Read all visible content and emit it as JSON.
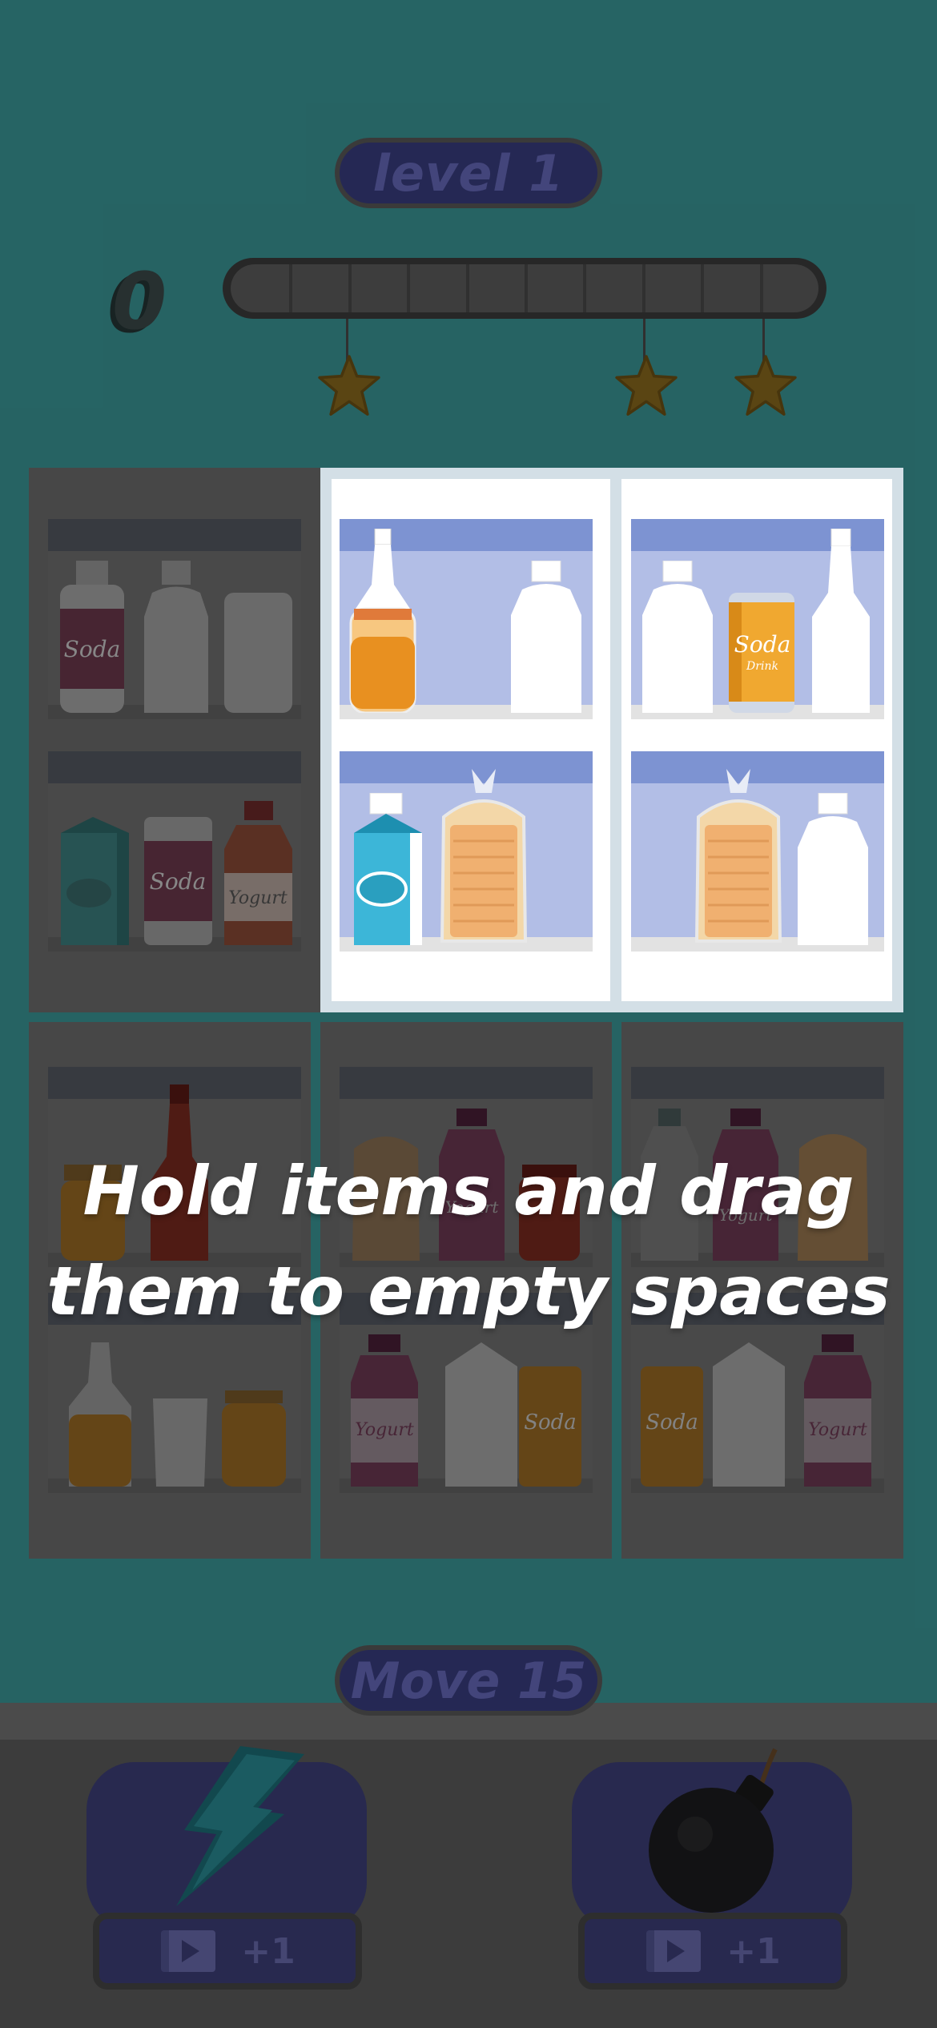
{
  "header": {
    "level_label": "level 1",
    "score": "0",
    "progress": 0,
    "progress_segments": 10,
    "stars": [
      {
        "name": "star-1",
        "threshold": 0.2
      },
      {
        "name": "star-2",
        "threshold": 0.7
      },
      {
        "name": "star-3",
        "threshold": 0.9
      }
    ]
  },
  "hint": {
    "line1": "Hold items and drag",
    "line2": "them to empty spaces"
  },
  "labels": {
    "soda": "Soda",
    "drink": "Drink",
    "yogurt": "Yogurt"
  },
  "footer": {
    "move_label": "Move 15",
    "boosters": [
      {
        "name": "lightning-booster",
        "icon": "lightning-icon",
        "reward": "+1"
      },
      {
        "name": "bomb-booster",
        "icon": "bomb-icon",
        "reward": "+1"
      }
    ]
  },
  "colors": {
    "background": "#3b9999",
    "pill": "#3a3e82",
    "pill_text": "#686bbd",
    "shelf_lit": "#b2bee6",
    "shelf_band_lit": "#7d93d2"
  }
}
